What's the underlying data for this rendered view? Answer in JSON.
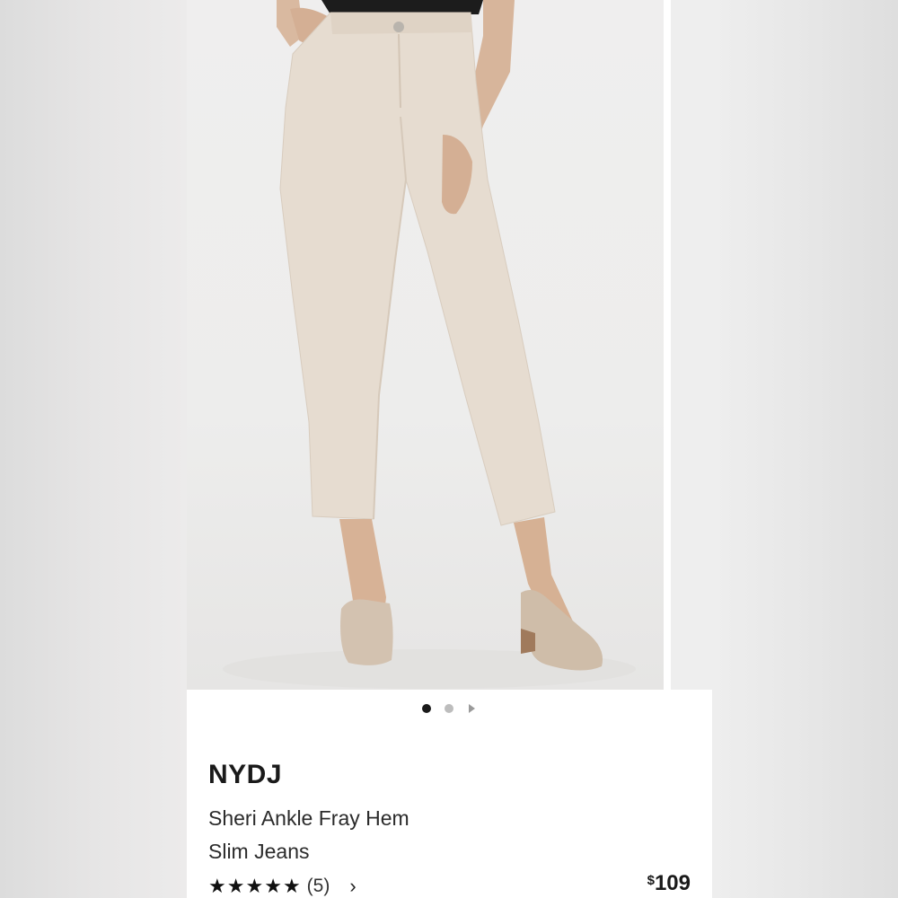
{
  "product": {
    "brand": "NYDJ",
    "name_line1": "Sheri Ankle Fray Hem",
    "name_line2": "Slim Jeans",
    "rating_stars": 5,
    "review_count": "(5)",
    "price_symbol": "$",
    "price_value": "109"
  },
  "carousel": {
    "active_index": 0,
    "total_slides": 3
  },
  "icons": {
    "star": "★",
    "chevron": "›"
  }
}
